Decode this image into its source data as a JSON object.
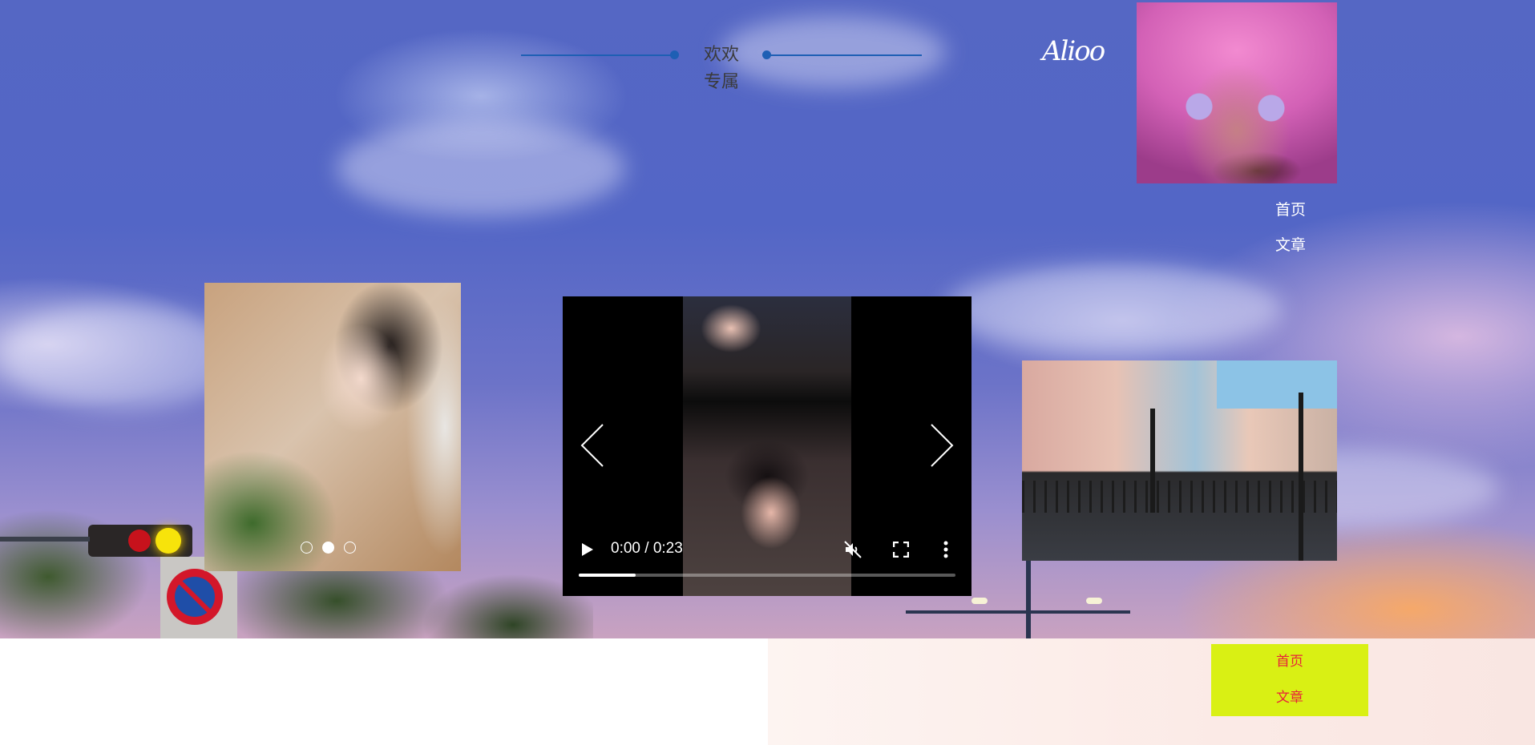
{
  "header": {
    "title_line1": "欢欢",
    "title_line2": "专属",
    "signature": "Alioo",
    "accent_color": "#1e5fb4"
  },
  "nav_top": {
    "items": [
      {
        "label": "首页"
      },
      {
        "label": "文章"
      }
    ]
  },
  "carousel": {
    "slide_count": 3,
    "active_index": 1
  },
  "video": {
    "current_time": "0:00",
    "duration": "0:23",
    "time_display": "0:00 / 0:23",
    "progress_fraction": 0.15,
    "muted": true,
    "icons": [
      "play-icon",
      "mute-icon",
      "fullscreen-icon",
      "more-options-icon",
      "chevron-left-icon",
      "chevron-right-icon"
    ]
  },
  "nav_bottom": {
    "items": [
      {
        "label": "首页"
      },
      {
        "label": "文章"
      }
    ],
    "background_color": "#d9f014",
    "text_color": "#e8233a"
  }
}
